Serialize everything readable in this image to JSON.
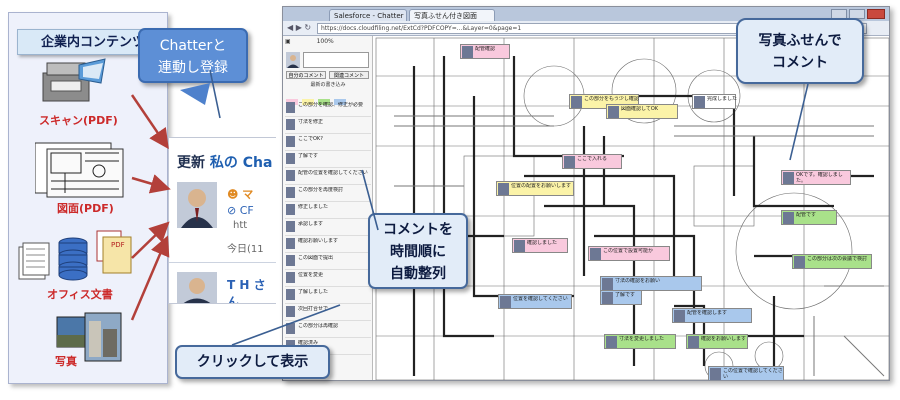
{
  "left_panel": {
    "title": "企業内コンテンツ",
    "items": [
      {
        "label": "スキャン(PDF)"
      },
      {
        "label": "図面(PDF)"
      },
      {
        "label": "オフィス文書"
      },
      {
        "label": "写真"
      }
    ]
  },
  "callouts": {
    "chatter_sync": "Chatterと\n連動し登録",
    "photo_sticky": "写真ふせんで\nコメント",
    "time_sort": "コメントを\n時間順に\n自動整列",
    "click_show": "クリックして表示"
  },
  "chatter_card": {
    "heading_prefix": "更新",
    "heading_accent": "私の Cha",
    "post_name_1": "マ",
    "post_line_1": "CF",
    "post_line_2": "htt",
    "timestamp": "今日(11",
    "post_name_2": "T H さん"
  },
  "browser": {
    "tabs": [
      "Salesforce - Chatter",
      "写真ふせん付き図面"
    ],
    "url": "https://docs.cloudfiling.net/ExtCd?PDFCOPY=...&Layer=0&page=1",
    "zoom": "100%",
    "sidebar_buttons": [
      "自分のコメント",
      "関連コメント"
    ],
    "sidebar_label": "最新の書き込み"
  },
  "sidebar_comments": [
    "この部分を確認、修正が必要",
    "寸法を修正",
    "ここでOK?",
    "了解です",
    "配管の位置を確認してください",
    "この部分を再度検討",
    "修正しました",
    "承認します",
    "確認お願いします",
    "この図面で提出",
    "位置を変更",
    "了解しました",
    "次回打合せで",
    "この部分は再確認",
    "確認済み"
  ],
  "sticky_notes": [
    {
      "text": "配管確認",
      "color": "#f9c9dd"
    },
    {
      "text": "この部分をもう少し確認",
      "color": "#fbf3a8"
    },
    {
      "text": "図面確認してOK",
      "color": "#fbf3a8"
    },
    {
      "text": "完成しました",
      "color": "#ffffff"
    },
    {
      "text": "ここで入れる",
      "color": "#f9c9dd"
    },
    {
      "text": "OKです。確認しました。",
      "color": "#f9c9dd"
    },
    {
      "text": "配管です",
      "color": "#a9e18a"
    },
    {
      "text": "位置の配置をお願いします",
      "color": "#fbf3a8"
    },
    {
      "text": "この位置で設置可能か",
      "color": "#f9c9dd"
    },
    {
      "text": "確認しました",
      "color": "#f9c9dd"
    },
    {
      "text": "この部分は次の会議で検討",
      "color": "#a9e18a"
    },
    {
      "text": "寸法の確認をお願い",
      "color": "#a9c8ec"
    },
    {
      "text": "了解です",
      "color": "#a9c8ec"
    },
    {
      "text": "位置を確認してください",
      "color": "#a9c8ec"
    },
    {
      "text": "配管を確認します",
      "color": "#a9c8ec"
    },
    {
      "text": "確認をお願いします",
      "color": "#a9e18a"
    },
    {
      "text": "寸法を変更しました",
      "color": "#a9e18a"
    },
    {
      "text": "この位置で確認してください",
      "color": "#a9c8ec"
    }
  ]
}
